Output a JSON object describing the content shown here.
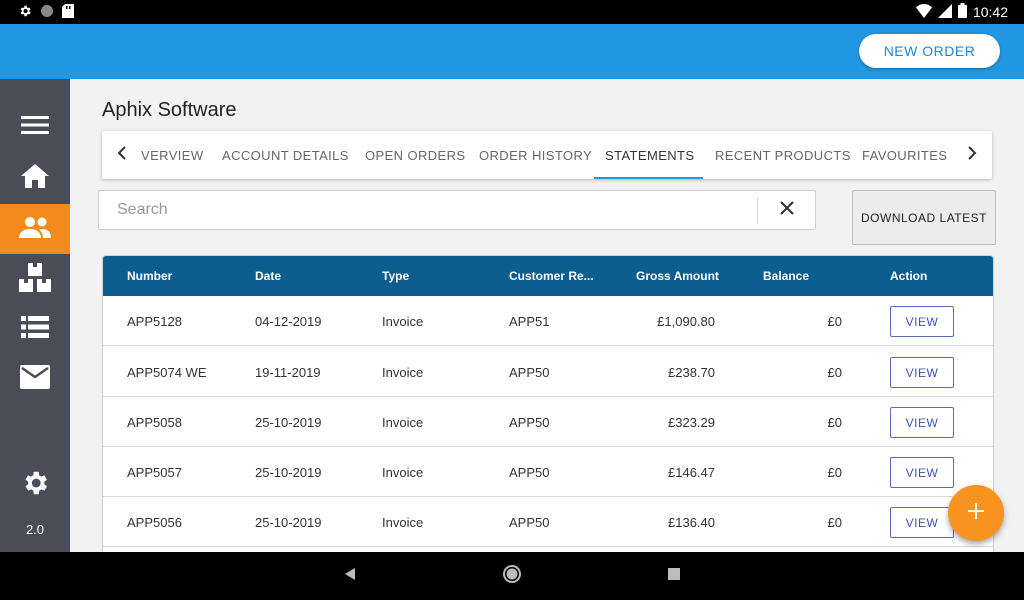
{
  "status_bar": {
    "time": "10:42"
  },
  "header": {
    "new_order_label": "NEW ORDER"
  },
  "sidebar": {
    "version": "2.0",
    "items": [
      {
        "icon": "menu-icon"
      },
      {
        "icon": "home-icon"
      },
      {
        "icon": "customers-icon",
        "active": true
      },
      {
        "icon": "products-icon"
      },
      {
        "icon": "list-icon"
      },
      {
        "icon": "mail-icon"
      },
      {
        "icon": "gear-icon"
      }
    ]
  },
  "main": {
    "title": "Aphix Software",
    "tabs": [
      {
        "label": "VERVIEW"
      },
      {
        "label": "ACCOUNT DETAILS"
      },
      {
        "label": "OPEN ORDERS"
      },
      {
        "label": "ORDER HISTORY"
      },
      {
        "label": "STATEMENTS",
        "active": true
      },
      {
        "label": "RECENT PRODUCTS"
      },
      {
        "label": "FAVOURITES"
      }
    ],
    "search": {
      "placeholder": "Search",
      "value": ""
    },
    "download_label": "DOWNLOAD LATEST"
  },
  "table": {
    "columns": [
      "Number",
      "Date",
      "Type",
      "Customer Re...",
      "Gross Amount",
      "Balance",
      "Action"
    ],
    "rows": [
      {
        "number": "APP5128",
        "date": "04-12-2019",
        "type": "Invoice",
        "customer_ref": "APP51",
        "gross": "£1,090.80",
        "balance": "£0",
        "action": "VIEW"
      },
      {
        "number": "APP5074 WE",
        "date": "19-11-2019",
        "type": "Invoice",
        "customer_ref": "APP50",
        "gross": "£238.70",
        "balance": "£0",
        "action": "VIEW"
      },
      {
        "number": "APP5058",
        "date": "25-10-2019",
        "type": "Invoice",
        "customer_ref": "APP50",
        "gross": "£323.29",
        "balance": "£0",
        "action": "VIEW"
      },
      {
        "number": "APP5057",
        "date": "25-10-2019",
        "type": "Invoice",
        "customer_ref": "APP50",
        "gross": "£146.47",
        "balance": "£0",
        "action": "VIEW"
      },
      {
        "number": "APP5056",
        "date": "25-10-2019",
        "type": "Invoice",
        "customer_ref": "APP50",
        "gross": "£136.40",
        "balance": "£0",
        "action": "VIEW"
      }
    ]
  },
  "colors": {
    "appbar": "#2196e3",
    "sidebar": "#4a4d58",
    "sidebar_active": "#f28a1e",
    "table_header": "#0d5d8f",
    "fab": "#f7931e"
  }
}
